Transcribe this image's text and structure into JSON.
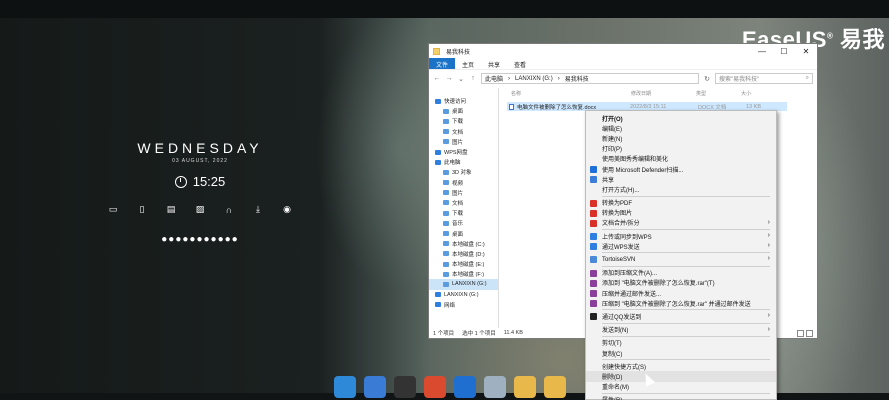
{
  "brand": {
    "name": "EaseUS",
    "reg": "®",
    "cn": "易我"
  },
  "lock": {
    "day": "WEDNESDAY",
    "date": "03 AUGUST, 2022",
    "time": "15:25",
    "dots": "●●●●●●●●●●●"
  },
  "explorer": {
    "title": "易我科技",
    "ribbon_tabs": [
      "文件",
      "主页",
      "共享",
      "查看"
    ],
    "path": [
      "此电脑",
      "LANXIXN (G:)",
      "易我科技"
    ],
    "search_placeholder": "搜索\"易我科技\"",
    "columns": [
      "名称",
      "修改日期",
      "类型",
      "大小"
    ],
    "file": {
      "name": "电脑文件被删除了怎么恢复.docx",
      "date": "2022/8/3 15:11",
      "type": "DOCX 文档",
      "size": "13 KB"
    },
    "nav_items": [
      {
        "label": "快速访问",
        "sub": false
      },
      {
        "label": "桌面",
        "sub": true
      },
      {
        "label": "下载",
        "sub": true
      },
      {
        "label": "文档",
        "sub": true
      },
      {
        "label": "图片",
        "sub": true
      },
      {
        "label": "WPS网盘",
        "sub": false
      },
      {
        "label": "此电脑",
        "sub": false
      },
      {
        "label": "3D 对象",
        "sub": true
      },
      {
        "label": "视频",
        "sub": true
      },
      {
        "label": "图片",
        "sub": true
      },
      {
        "label": "文档",
        "sub": true
      },
      {
        "label": "下载",
        "sub": true
      },
      {
        "label": "音乐",
        "sub": true
      },
      {
        "label": "桌面",
        "sub": true
      },
      {
        "label": "本地磁盘 (C:)",
        "sub": true
      },
      {
        "label": "本地磁盘 (D:)",
        "sub": true
      },
      {
        "label": "本地磁盘 (E:)",
        "sub": true
      },
      {
        "label": "本地磁盘 (F:)",
        "sub": true
      },
      {
        "label": "LANXIXN (G:)",
        "sub": true
      },
      {
        "label": "LANXIXN (G:)",
        "sub": false
      },
      {
        "label": "网络",
        "sub": false
      }
    ],
    "status": {
      "count": "1 个项目",
      "selected": "选中 1 个项目",
      "size": "11.4 KB"
    }
  },
  "context_menu": {
    "items": [
      {
        "label": "打开(O)",
        "bold": true
      },
      {
        "label": "编辑(E)"
      },
      {
        "label": "新建(N)"
      },
      {
        "label": "打印(P)"
      },
      {
        "label": "使用美图秀秀编辑和美化"
      },
      {
        "label": "使用 Microsoft Defender扫描...",
        "icon": "#1e6fd9"
      },
      {
        "label": "共享",
        "icon": "#3b7dd8"
      },
      {
        "label": "打开方式(H)..."
      },
      {
        "sep": true
      },
      {
        "label": "转换为PDF",
        "icon": "#d9302a"
      },
      {
        "label": "转换为图片",
        "icon": "#d9302a"
      },
      {
        "label": "文档合并/拆分",
        "icon": "#d9302a",
        "arrow": true
      },
      {
        "sep": true
      },
      {
        "label": "上传或同步到WPS",
        "icon": "#2f7fe0",
        "arrow": true
      },
      {
        "label": "通过WPS发送",
        "icon": "#2f7fe0",
        "arrow": true
      },
      {
        "sep": true
      },
      {
        "label": "TortoiseSVN",
        "icon": "#4a8ad8",
        "arrow": true
      },
      {
        "sep": true
      },
      {
        "label": "添加到压缩文件(A)...",
        "icon": "#8a3f9b"
      },
      {
        "label": "添加到 \"电脑文件被删除了怎么恢复.rar\"(T)",
        "icon": "#8a3f9b"
      },
      {
        "label": "压缩并通过邮件发送...",
        "icon": "#8a3f9b"
      },
      {
        "label": "压缩到 \"电脑文件被删除了怎么恢复.rar\" 并通过邮件发送",
        "icon": "#8a3f9b"
      },
      {
        "sep": true
      },
      {
        "label": "通过QQ发送到",
        "icon": "#222222",
        "arrow": true
      },
      {
        "sep": true
      },
      {
        "label": "发送到(N)",
        "arrow": true
      },
      {
        "sep": true
      },
      {
        "label": "剪切(T)"
      },
      {
        "label": "复制(C)"
      },
      {
        "sep": true
      },
      {
        "label": "创建快捷方式(S)"
      },
      {
        "label": "删除(D)",
        "hover": true
      },
      {
        "label": "重命名(M)"
      },
      {
        "sep": true
      },
      {
        "label": "属性(R)"
      }
    ]
  },
  "taskbar": [
    {
      "name": "toolbox",
      "color": "#2e8ad8"
    },
    {
      "name": "bird",
      "color": "#3a7bd5"
    },
    {
      "name": "media",
      "color": "#333333"
    },
    {
      "name": "recorder",
      "color": "#d94a2e"
    },
    {
      "name": "chart",
      "color": "#1f6fd1"
    },
    {
      "name": "recycle-bin",
      "color": "#9fb0c0"
    },
    {
      "name": "folder-1",
      "color": "#e8b84a"
    },
    {
      "name": "folder-2",
      "color": "#e8b84a"
    }
  ]
}
